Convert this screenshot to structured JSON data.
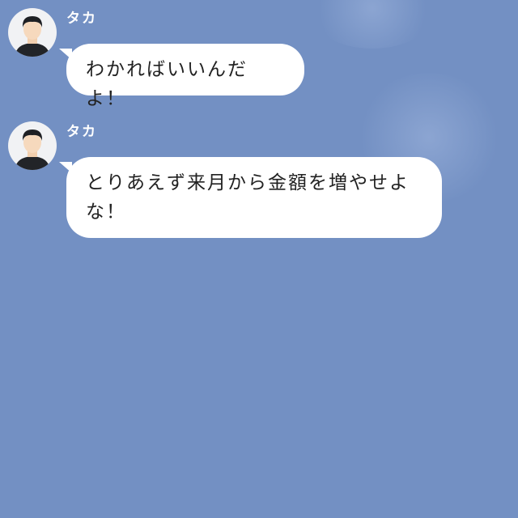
{
  "colors": {
    "background": "#7390c3",
    "bubble": "#ffffff",
    "sender_name": "#ffffff",
    "message_text": "#222222"
  },
  "messages": [
    {
      "sender": "タカ",
      "avatar_icon": "person-avatar-icon",
      "text": "わかればいいんだよ！"
    },
    {
      "sender": "タカ",
      "avatar_icon": "person-avatar-icon",
      "text": "とりあえず来月から金額を増やせよ\nな！"
    }
  ]
}
